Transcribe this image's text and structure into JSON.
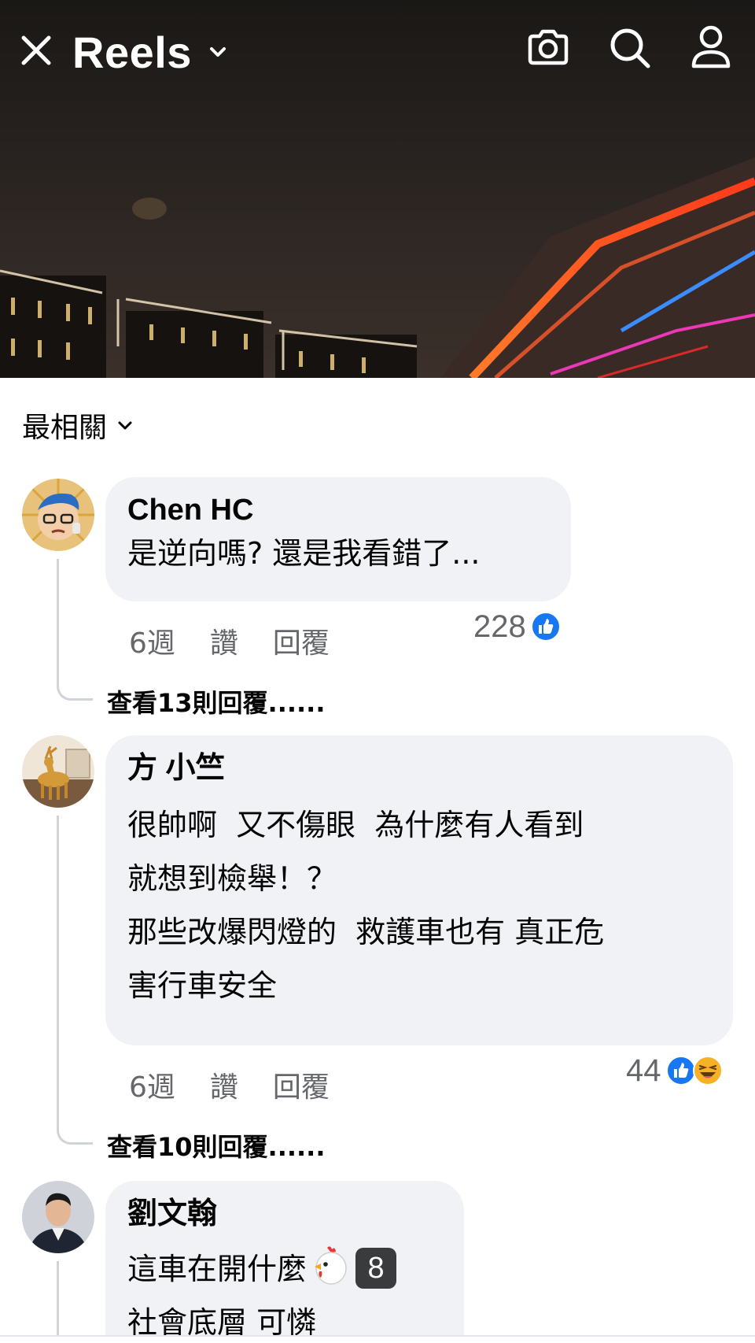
{
  "header": {
    "title": "Reels",
    "icons": [
      "close-icon",
      "chevron-down-icon",
      "camera-icon",
      "search-icon",
      "profile-icon"
    ]
  },
  "sort": {
    "label": "最相關"
  },
  "comments": [
    {
      "author": "Chen HC",
      "text": "是逆向嗎? 還是我看錯了...",
      "time": "6週",
      "like": "讚",
      "reply": "回覆",
      "reaction_count": "228",
      "reactions": [
        "like-reaction-icon"
      ],
      "view_replies": "查看13則回覆......"
    },
    {
      "author": "方 小竺",
      "text": "很帥啊  又不傷眼  為什麼有人看到\n就想到檢舉！？\n那些改爆閃燈的  救護車也有 真正危\n害行車安全",
      "time": "6週",
      "like": "讚",
      "reply": "回覆",
      "reaction_count": "44",
      "reactions": [
        "like-reaction-icon",
        "haha-reaction-icon"
      ],
      "view_replies": "查看10則回覆......"
    },
    {
      "author": "劉文翰",
      "text_line1": "這車在開什麼",
      "emoji": "chicken-icon",
      "badge": "8",
      "text_line2": "社會底層 可憐"
    }
  ],
  "colors": {
    "bubble": "#f0f2f5",
    "meta_text": "#65676b",
    "like_blue": "#1877f2",
    "haha_yellow": "#f7b125"
  }
}
